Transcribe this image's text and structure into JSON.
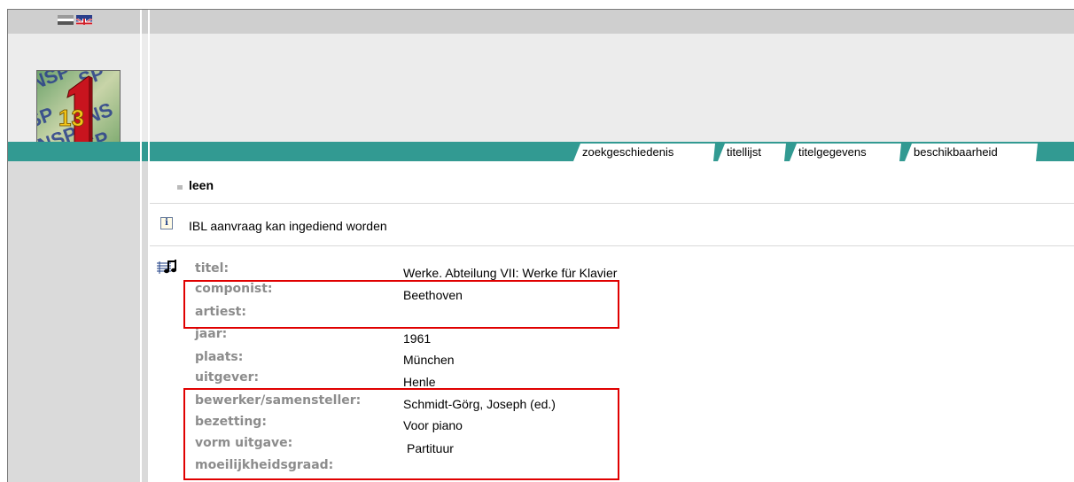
{
  "lang_switcher": {
    "icons": [
      "nl-flag-icon",
      "uk-flag-icon"
    ]
  },
  "logo": {
    "icon": "numeric-13-logo"
  },
  "tabs": [
    {
      "label": "zoekgeschiedenis"
    },
    {
      "label": "titellijst"
    },
    {
      "label": "titelgegevens"
    },
    {
      "label": "beschikbaarheid"
    }
  ],
  "section": {
    "title": "leen"
  },
  "notice": {
    "icon": "info-icon",
    "text": "IBL aanvraag kan ingediend worden"
  },
  "record": {
    "icon": "sheet-music-icon",
    "fields": [
      {
        "label": "titel:",
        "value": "Werke. Abteilung VII: Werke für Klavier"
      },
      {
        "label": "componist:",
        "value": "Beethoven"
      },
      {
        "label": "artiest:",
        "value": ""
      },
      {
        "label": "jaar:",
        "value": "1961"
      },
      {
        "label": "plaats:",
        "value": "München"
      },
      {
        "label": "uitgever:",
        "value": "Henle"
      },
      {
        "label": "bewerker/samensteller:",
        "value": "Schmidt-Görg, Joseph (ed.)"
      },
      {
        "label": "bezetting:",
        "value": "Voor piano"
      },
      {
        "label": "vorm uitgave:",
        "value": "Partituur"
      },
      {
        "label": "moeilijkheidsgraad:",
        "value": ""
      }
    ]
  },
  "colors": {
    "teal": "#329a92",
    "highlight": "#e00000",
    "label_gray": "#8c8c8c"
  }
}
